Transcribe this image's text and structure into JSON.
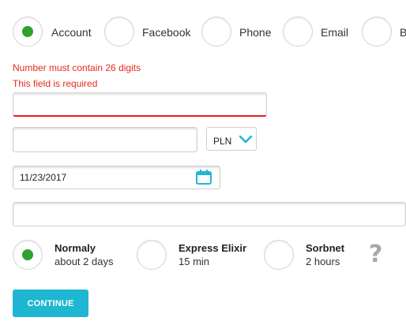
{
  "login_methods": [
    {
      "label": "Account",
      "selected": true
    },
    {
      "label": "Facebook",
      "selected": false
    },
    {
      "label": "Phone",
      "selected": false
    },
    {
      "label": "Email",
      "selected": false
    },
    {
      "label": "B",
      "selected": false
    }
  ],
  "errors": {
    "digits": "Number must contain 26 digits",
    "required": "This field is required"
  },
  "account_number": {
    "value": ""
  },
  "amount": {
    "value": ""
  },
  "currency": {
    "selected": "PLN",
    "icon": "chevron-down-icon"
  },
  "date": {
    "value": "11/23/2017",
    "icon": "calendar-icon"
  },
  "title_field": {
    "value": ""
  },
  "shipping": [
    {
      "title": "Normaly",
      "subtitle": "about 2 days",
      "selected": true
    },
    {
      "title": "Express Elixir",
      "subtitle": "15 min",
      "selected": false
    },
    {
      "title": "Sorbnet",
      "subtitle": "2 hours",
      "selected": false
    }
  ],
  "help_icon": "?",
  "continue_label": "CONTINUE",
  "colors": {
    "accent": "#1fb6d1",
    "selected": "#2ea32e",
    "error": "#e52a1f"
  }
}
